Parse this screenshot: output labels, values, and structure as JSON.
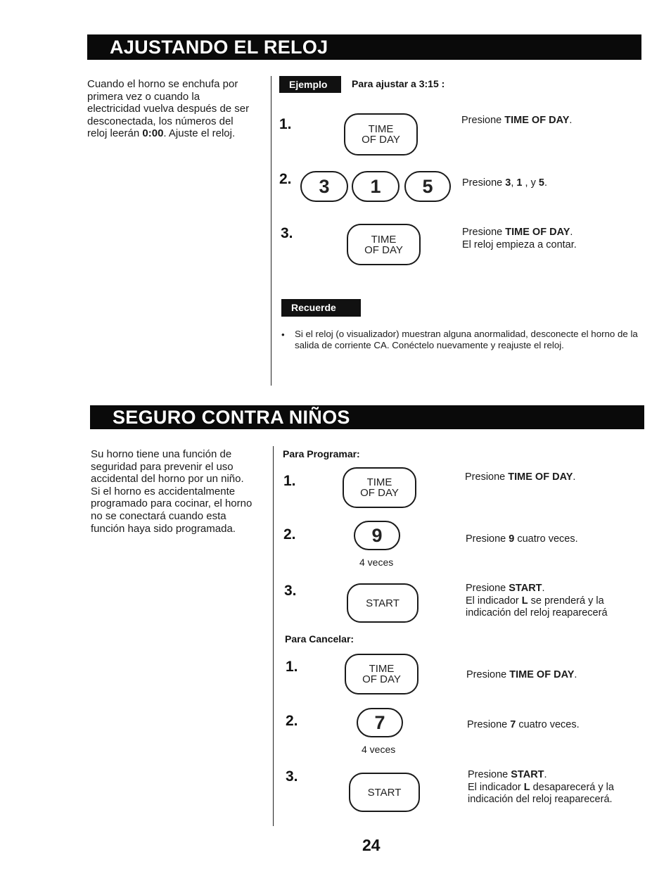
{
  "section1": {
    "title": "AJUSTANDO EL RELOJ",
    "intro_parts": [
      "Cuando el horno se enchufa por primera vez o cuando la electricidad vuelva después de ser desconectada, los números del reloj leerán ",
      "0:00",
      ". Ajuste el reloj."
    ],
    "example_tag": "Ejemplo",
    "example_text": "Para ajustar a 3:15 :",
    "steps": [
      {
        "number": "1.",
        "key_line1": "TIME",
        "key_line2": "OF DAY",
        "desc_pre": "Presione ",
        "desc_bold": "TIME OF DAY",
        "desc_post": "."
      },
      {
        "number": "2.",
        "keys": [
          "3",
          "1",
          "5"
        ],
        "desc_pre": "Presione ",
        "desc_bold1": "3",
        "desc_sep1": ", ",
        "desc_bold2": "1",
        "desc_sep2": " , y ",
        "desc_bold3": "5",
        "desc_post": "."
      },
      {
        "number": "3.",
        "key_line1": "TIME",
        "key_line2": "OF DAY",
        "desc_pre": "Presione ",
        "desc_bold": "TIME OF DAY",
        "desc_post": ".",
        "desc_line2": "El reloj empieza a contar."
      }
    ],
    "reminder_tag": "Recuerde",
    "reminder_bullet": "•",
    "reminder_text": "Si el reloj (o visualizador) muestran alguna anormalidad, desconecte el horno de la salida de corriente CA. Conéctelo nuevamente y reajuste el reloj."
  },
  "section2": {
    "title": "SEGURO CONTRA NIÑOS",
    "intro": "Su horno tiene una función de seguridad para prevenir el uso accidental del horno por un niño.",
    "intro2": "Si el horno es accidentalmente programado para cocinar, el horno no se conectará cuando esta función haya sido programada.",
    "program": {
      "label": "Para Programar:",
      "steps": [
        {
          "number": "1.",
          "key_line1": "TIME",
          "key_line2": "OF DAY",
          "desc_pre": "Presione ",
          "desc_bold": "TIME OF DAY",
          "desc_post": "."
        },
        {
          "number": "2.",
          "key": "9",
          "note": "4 veces",
          "desc_pre": "Presione ",
          "desc_bold": "9",
          "desc_post": " cuatro veces."
        },
        {
          "number": "3.",
          "key_label": "START",
          "desc_pre": "Presione ",
          "desc_bold": "START",
          "desc_post": ".",
          "desc2_pre": "El indicador ",
          "desc2_bold": "L",
          "desc2_post": " se prenderá y la indicación del reloj reaparecerá"
        }
      ]
    },
    "cancel": {
      "label": "Para Cancelar:",
      "steps": [
        {
          "number": "1.",
          "key_line1": "TIME",
          "key_line2": "OF DAY",
          "desc_pre": "Presione ",
          "desc_bold": "TIME OF DAY",
          "desc_post": "."
        },
        {
          "number": "2.",
          "key": "7",
          "note": "4 veces",
          "desc_pre": "Presione ",
          "desc_bold": "7",
          "desc_post": " cuatro veces."
        },
        {
          "number": "3.",
          "key_label": "START",
          "desc_pre": "Presione ",
          "desc_bold": "START",
          "desc_post": ".",
          "desc2_pre": "El indicador ",
          "desc2_bold": "L",
          "desc2_post": " desaparecerá y la indicación del reloj reaparecerá."
        }
      ]
    }
  },
  "page_number": "24"
}
